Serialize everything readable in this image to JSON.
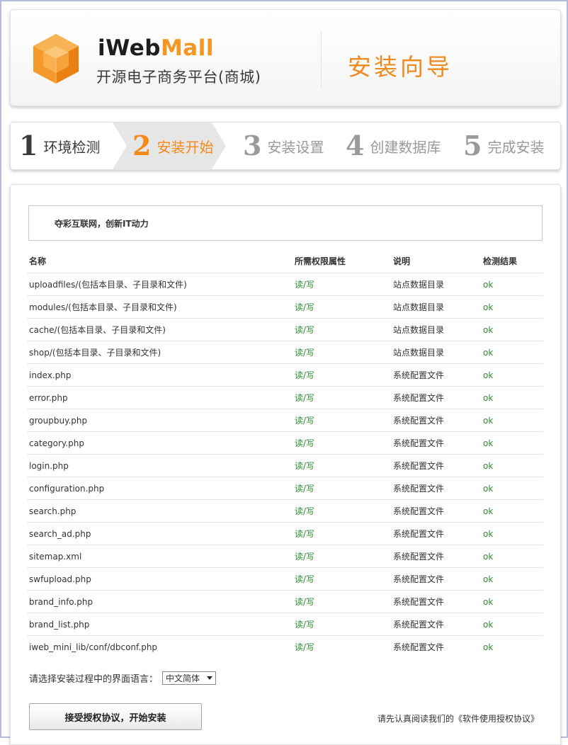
{
  "header": {
    "brand_part1": "iWeb",
    "brand_part2": "Mall",
    "tagline": "开源电子商务平台(商城)",
    "wizard_title": "安装向导",
    "accent_color": "#f39722"
  },
  "steps": [
    {
      "num": "1",
      "label": "环境检测",
      "state": "done"
    },
    {
      "num": "2",
      "label": "安装开始",
      "state": "active"
    },
    {
      "num": "3",
      "label": "安装设置",
      "state": "pending"
    },
    {
      "num": "4",
      "label": "创建数据库",
      "state": "pending"
    },
    {
      "num": "5",
      "label": "完成安装",
      "state": "pending"
    }
  ],
  "notice": "夺彩互联网，创新IT动力",
  "table": {
    "headers": [
      "名称",
      "所需权限属性",
      "说明",
      "检测结果"
    ],
    "rows": [
      [
        "uploadfiles/(包括本目录、子目录和文件)",
        "读/写",
        "站点数据目录",
        "ok"
      ],
      [
        "modules/(包括本目录、子目录和文件)",
        "读/写",
        "站点数据目录",
        "ok"
      ],
      [
        "cache/(包括本目录、子目录和文件)",
        "读/写",
        "站点数据目录",
        "ok"
      ],
      [
        "shop/(包括本目录、子目录和文件)",
        "读/写",
        "站点数据目录",
        "ok"
      ],
      [
        "index.php",
        "读/写",
        "系统配置文件",
        "ok"
      ],
      [
        "error.php",
        "读/写",
        "系统配置文件",
        "ok"
      ],
      [
        "groupbuy.php",
        "读/写",
        "系统配置文件",
        "ok"
      ],
      [
        "category.php",
        "读/写",
        "系统配置文件",
        "ok"
      ],
      [
        "login.php",
        "读/写",
        "系统配置文件",
        "ok"
      ],
      [
        "configuration.php",
        "读/写",
        "系统配置文件",
        "ok"
      ],
      [
        "search.php",
        "读/写",
        "系统配置文件",
        "ok"
      ],
      [
        "search_ad.php",
        "读/写",
        "系统配置文件",
        "ok"
      ],
      [
        "sitemap.xml",
        "读/写",
        "系统配置文件",
        "ok"
      ],
      [
        "swfupload.php",
        "读/写",
        "系统配置文件",
        "ok"
      ],
      [
        "brand_info.php",
        "读/写",
        "系统配置文件",
        "ok"
      ],
      [
        "brand_list.php",
        "读/写",
        "系统配置文件",
        "ok"
      ],
      [
        "iweb_mini_lib/conf/dbconf.php",
        "读/写",
        "系统配置文件",
        "ok"
      ]
    ]
  },
  "language": {
    "label": "请选择安装过程中的界面语言：",
    "selected": "中文简体"
  },
  "accept_button": "接受授权协议，开始安装",
  "license_note": {
    "prefix": "请先认真阅读我们的",
    "link": "《软件使用授权协议》"
  }
}
